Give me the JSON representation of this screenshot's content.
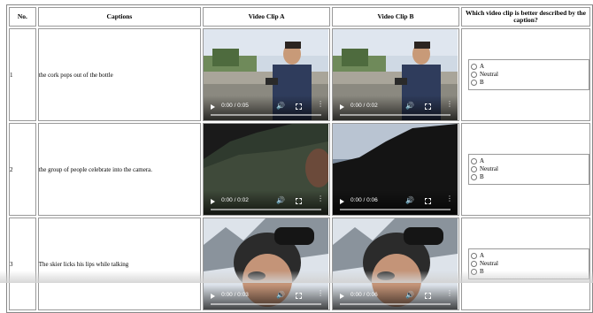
{
  "header": {
    "no": "No.",
    "captions": "Captions",
    "clip_a": "Video Clip A",
    "clip_b": "Video Clip B",
    "question": "Which video clip is better described by the caption?"
  },
  "rows": [
    {
      "num": "1",
      "caption": "the cork pops out of the bottle",
      "clip_a_time": "0:00 / 0:05",
      "clip_b_time": "0:00 / 0:02",
      "options": [
        "A",
        "Neutral",
        "B"
      ]
    },
    {
      "num": "2",
      "caption": "the group of people celebrate into the camera.",
      "clip_a_time": "0:00 / 0:02",
      "clip_b_time": "0:00 / 0:06",
      "options": [
        "A",
        "Neutral",
        "B"
      ]
    },
    {
      "num": "3",
      "caption": "The skier licks his lips while talking",
      "clip_a_time": "0:00 / 0:03",
      "clip_b_time": "0:00 / 0:06",
      "options": [
        "A",
        "Neutral",
        "B"
      ]
    }
  ],
  "icons": {
    "play": "play-icon",
    "volume": "volume-icon",
    "fullscreen": "fullscreen-icon",
    "more": "more-options-icon"
  }
}
